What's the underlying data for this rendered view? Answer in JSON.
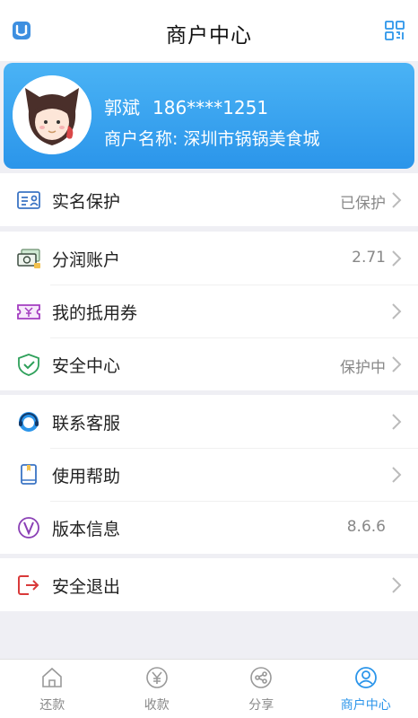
{
  "header": {
    "title": "商户中心",
    "logo_icon": "app-logo-icon",
    "qr_icon": "qr-code-icon"
  },
  "profile": {
    "name": "郭斌",
    "phone": "186****1251",
    "merchant_label": "商户名称:",
    "merchant_name": "深圳市锅锅美食城"
  },
  "groups": [
    {
      "items": [
        {
          "label": "实名保护",
          "value": "已保护",
          "icon": "id-card-icon"
        }
      ]
    },
    {
      "items": [
        {
          "label": "分润账户",
          "value": "2.71",
          "icon": "money-icon"
        },
        {
          "label": "我的抵用券",
          "value": "",
          "icon": "coupon-icon"
        },
        {
          "label": "安全中心",
          "value": "保护中",
          "icon": "shield-icon"
        }
      ]
    },
    {
      "items": [
        {
          "label": "联系客服",
          "value": "",
          "icon": "customer-service-icon"
        },
        {
          "label": "使用帮助",
          "value": "",
          "icon": "help-book-icon"
        },
        {
          "label": "版本信息",
          "value": "8.6.6",
          "icon": "version-icon"
        }
      ]
    },
    {
      "items": [
        {
          "label": "安全退出",
          "value": "",
          "icon": "logout-icon"
        }
      ]
    }
  ],
  "tabs": [
    {
      "label": "还款",
      "icon": "home-icon",
      "active": false
    },
    {
      "label": "收款",
      "icon": "yen-icon",
      "active": false
    },
    {
      "label": "分享",
      "icon": "share-icon",
      "active": false
    },
    {
      "label": "商户中心",
      "icon": "user-icon",
      "active": true
    }
  ],
  "colors": {
    "accent": "#2b95ea",
    "background": "#efeff4"
  }
}
